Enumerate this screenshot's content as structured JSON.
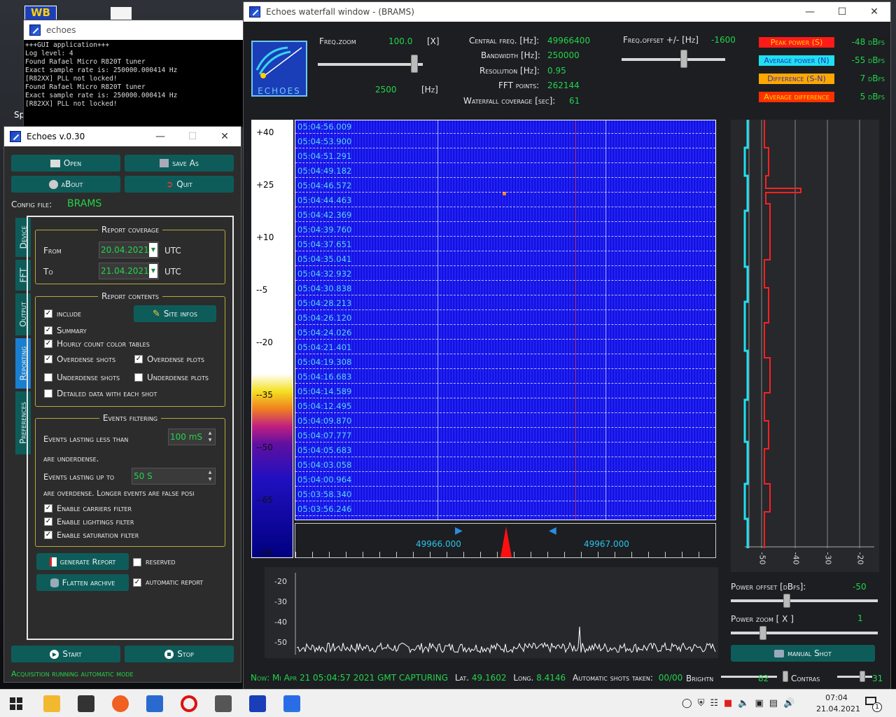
{
  "desktop": {
    "icon_label": "WB",
    "partial_text": "Sp"
  },
  "console": {
    "title": "echoes",
    "lines": "+++GUI application+++\nLog level: 4\nFound Rafael Micro R820T tuner\nExact sample rate is: 250000.000414 Hz\n[R82XX] PLL not locked!\nFound Rafael Micro R820T tuner\nExact sample rate is: 250000.000414 Hz\n[R82XX] PLL not locked!"
  },
  "settings": {
    "title": "Echoes v.0.30",
    "buttons": {
      "open": "Open",
      "save_as": "save As",
      "about": "aBout",
      "quit": "Quit",
      "generate_report": "generate Report",
      "flatten_archive": "Flatten archive",
      "start": "Start",
      "stop": "Stop"
    },
    "config_file_label": "Config file:",
    "config_file_value": "BRAMS",
    "tabs": [
      "Device",
      "FFT",
      "Output",
      "Reporting",
      "Preferences"
    ],
    "report_coverage": {
      "title": "Report coverage",
      "from_label": "From",
      "from_value": "20.04.2021",
      "to_label": "To",
      "to_value": "21.04.2021",
      "utc": "UTC"
    },
    "report_contents": {
      "title": "Report contents",
      "site_infos": "Site infos",
      "items": [
        {
          "label": "include",
          "checked": true
        },
        {
          "label": "Summary",
          "checked": true
        },
        {
          "label": "Hourly count color tables",
          "checked": true
        },
        {
          "label": "Overdense shots",
          "checked": true
        },
        {
          "label": "Overdense plots",
          "checked": true
        },
        {
          "label": "Underdense shots",
          "checked": false
        },
        {
          "label": "Underdense plots",
          "checked": false
        },
        {
          "label": "Detailed data with each shot",
          "checked": false
        }
      ]
    },
    "events_filtering": {
      "title": "Events filtering",
      "less_than_label": "Events lasting less than",
      "less_than_value": "100 mS",
      "underdense_text": "are underdense.",
      "up_to_label": "Events lasting up to",
      "up_to_value": "50 S",
      "overdense_text": "are overdense. Longer events are false posi",
      "filters": [
        {
          "label": "Enable carriers filter",
          "checked": true
        },
        {
          "label": "Enable lightings filter",
          "checked": true
        },
        {
          "label": "Enable saturation filter",
          "checked": true
        }
      ]
    },
    "reserved": {
      "label": "reserved",
      "checked": false
    },
    "automatic_report": {
      "label": "automatic report",
      "checked": true
    },
    "status": "Acquisition running automatic mode"
  },
  "waterfall": {
    "title": "Echoes waterfall window - (BRAMS)",
    "logo_text": "ECHOES",
    "freq_zoom_label": "Freq.zoom",
    "freq_zoom_value": "100.0",
    "freq_zoom_unit": "[X]",
    "freq_zoom_level": 0.92,
    "span_value": "2500",
    "span_unit": "[Hz]",
    "central_freq_label": "Central freq. [Hz]:",
    "central_freq_value": "49966400",
    "bandwidth_label": "Bandwidth [Hz]:",
    "bandwidth_value": "250000",
    "resolution_label": "Resolution [Hz]:",
    "resolution_value": "0.95",
    "fft_label": "FFT points:",
    "fft_value": "262144",
    "coverage_label": "Waterfall coverage [sec]:",
    "coverage_value": "61",
    "freq_offset_label": "Freq.offset +/- [Hz]",
    "freq_offset_value": "-1600",
    "freq_offset_level": 0.6,
    "legend": [
      {
        "label": "Peak power (S)",
        "value": "-48 dBfs",
        "bg": "#ff1a1a",
        "fg": "#ffd800"
      },
      {
        "label": "Average power (N)",
        "value": "-55 dBfs",
        "bg": "#1fe0f0",
        "fg": "#2030c0"
      },
      {
        "label": "Difference (S-N)",
        "value": "7 dBfs",
        "bg": "#ffa800",
        "fg": "#3030b0"
      },
      {
        "label": "Average difference",
        "value": "5 dBfs",
        "bg": "#ff3000",
        "fg": "#ffe000"
      }
    ],
    "scale_labels": [
      "+40",
      "+25",
      "+10",
      "--5",
      "--20",
      "--35",
      "--50",
      "--65",
      "--80"
    ],
    "timestamps": [
      "05:04:56.009",
      "05:04:53.900",
      "05:04:51.291",
      "05:04:49.182",
      "05:04:46.572",
      "05:04:44.463",
      "05:04:42.369",
      "05:04:39.760",
      "05:04:37.651",
      "05:04:35.041",
      "05:04:32.932",
      "05:04:30.838",
      "05:04:28.213",
      "05:04:26.120",
      "05:04:24.026",
      "05:04:21.401",
      "05:04:19.308",
      "05:04:16.683",
      "05:04:14.589",
      "05:04:12.495",
      "05:04:09.870",
      "05:04:07.777",
      "05:04:05.683",
      "05:04:03.058",
      "05:04:00.964",
      "05:03:58.340",
      "05:03:56.246"
    ],
    "freq_ticks": [
      "49966.000",
      "49967.000"
    ],
    "power_axis": [
      "-50",
      "-40",
      "-30",
      "-20"
    ],
    "spectrum_axis": [
      "-20",
      "-30",
      "-40",
      "-50"
    ],
    "power_offset_label": "Power offset [dBfs]:",
    "power_offset_value": "-50",
    "power_offset_level": 0.38,
    "power_zoom_label": "Power zoom  [ X ]",
    "power_zoom_value": "1",
    "power_zoom_level": 0.22,
    "manual_shot": "manual Shot",
    "status": {
      "now": "Now: Mi Apr 21 05:04:57 2021 GMT CAPTURING",
      "lat_label": "Lat.",
      "lat_value": "49.1602",
      "long_label": "Long.",
      "long_value": "8.4146",
      "shots_label": "Automatic shots taken:",
      "shots_value": "00/00",
      "brightness_label": "Brightn",
      "brightness_value": "82",
      "contrast_label": "Contras",
      "contrast_value": "31"
    }
  },
  "taskbar": {
    "time": "07:04",
    "date": "21.04.2021",
    "notifications": "1"
  }
}
